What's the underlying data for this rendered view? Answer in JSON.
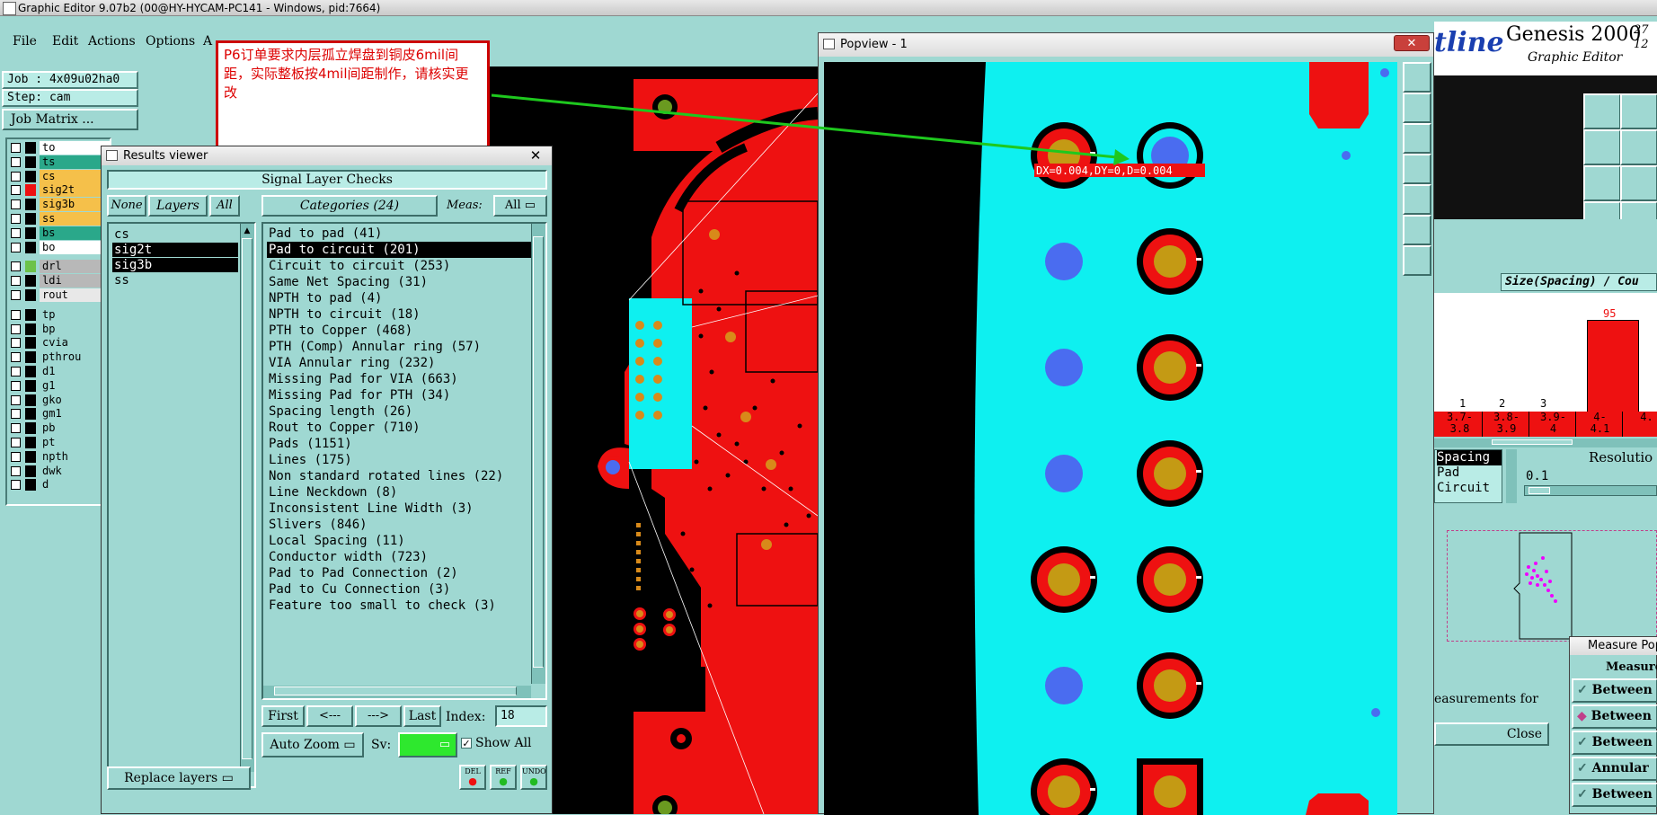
{
  "titlebar": {
    "title": "Graphic Editor 9.07b2 (00@HY-HYCAM-PC141 - Windows, pid:7664)"
  },
  "menu": {
    "file": "File",
    "edit": "Edit",
    "actions": "Actions",
    "options": "Options",
    "a": "A"
  },
  "job": {
    "job_line": "Job : 4x09u02ha0",
    "step_line": "Step: cam",
    "matrix_button": "Job Matrix ..."
  },
  "layers": [
    {
      "name": "to",
      "color": "#ffffff"
    },
    {
      "name": "ts",
      "color": "#2aa88a"
    },
    {
      "name": "cs",
      "color": "#f5c04a"
    },
    {
      "name": "sig2t",
      "color": "#f5c04a",
      "swatch": "#e11"
    },
    {
      "name": "sig3b",
      "color": "#f5c04a"
    },
    {
      "name": "ss",
      "color": "#f5c04a"
    },
    {
      "name": "bs",
      "color": "#2aa88a"
    },
    {
      "name": "bo",
      "color": "#ffffff"
    },
    {
      "name": "drl",
      "color": "#b8b8b8",
      "swatch": "#6cc24a"
    },
    {
      "name": "ldi",
      "color": "#b8b8b8"
    },
    {
      "name": "rout",
      "color": "#e8e8e8"
    },
    {
      "name": "tp",
      "color": "#9fd8d2"
    },
    {
      "name": "bp",
      "color": "#9fd8d2"
    },
    {
      "name": "cvia",
      "color": "#9fd8d2"
    },
    {
      "name": "pthrou",
      "color": "#9fd8d2"
    },
    {
      "name": "d1",
      "color": "#9fd8d2"
    },
    {
      "name": "g1",
      "color": "#9fd8d2"
    },
    {
      "name": "gko",
      "color": "#9fd8d2"
    },
    {
      "name": "gm1",
      "color": "#9fd8d2"
    },
    {
      "name": "pb",
      "color": "#9fd8d2"
    },
    {
      "name": "pt",
      "color": "#9fd8d2"
    },
    {
      "name": "npth",
      "color": "#9fd8d2"
    },
    {
      "name": "dwk",
      "color": "#9fd8d2"
    },
    {
      "name": "d",
      "color": "#9fd8d2"
    }
  ],
  "note": {
    "text": "P6订单要求内层孤立焊盘到铜皮6mil间距，实际整板按4mil间距制作，请核实更改"
  },
  "results_viewer": {
    "title": "Results viewer",
    "header": "Signal Layer Checks",
    "none": "None",
    "layers": "Layers",
    "all": "All",
    "categories": "Categories (24)",
    "meas": "Meas:",
    "meas_value": "All",
    "layer_list": [
      {
        "name": "cs",
        "selected": false
      },
      {
        "name": "sig2t",
        "selected": true
      },
      {
        "name": "sig3b",
        "selected": true
      },
      {
        "name": "ss",
        "selected": false
      }
    ],
    "category_list": [
      {
        "label": "Pad to pad (41)",
        "selected": false
      },
      {
        "label": "Pad to circuit (201)",
        "selected": true
      },
      {
        "label": "Circuit to circuit (253)",
        "selected": false
      },
      {
        "label": "Same Net Spacing (31)",
        "selected": false
      },
      {
        "label": "NPTH to pad (4)",
        "selected": false
      },
      {
        "label": "NPTH to circuit (18)",
        "selected": false
      },
      {
        "label": "PTH to Copper (468)",
        "selected": false
      },
      {
        "label": "PTH (Comp) Annular ring (57)",
        "selected": false
      },
      {
        "label": "VIA Annular ring (232)",
        "selected": false
      },
      {
        "label": "Missing Pad for VIA (663)",
        "selected": false
      },
      {
        "label": "Missing Pad for PTH (34)",
        "selected": false
      },
      {
        "label": "Spacing length (26)",
        "selected": false
      },
      {
        "label": "Rout to Copper (710)",
        "selected": false
      },
      {
        "label": "Pads (1151)",
        "selected": false
      },
      {
        "label": "Lines (175)",
        "selected": false
      },
      {
        "label": "Non standard rotated lines (22)",
        "selected": false
      },
      {
        "label": "Line Neckdown (8)",
        "selected": false
      },
      {
        "label": "Inconsistent Line Width (3)",
        "selected": false
      },
      {
        "label": "Slivers (846)",
        "selected": false
      },
      {
        "label": "Local Spacing (11)",
        "selected": false
      },
      {
        "label": "Conductor width (723)",
        "selected": false
      },
      {
        "label": "Pad to Pad Connection (2)",
        "selected": false
      },
      {
        "label": "Pad to Cu Connection (3)",
        "selected": false
      },
      {
        "label": "Feature too small to check (3)",
        "selected": false
      }
    ],
    "first": "First",
    "prev": "<---",
    "next": "--->",
    "last": "Last",
    "index_label": "Index:",
    "index_value": "18",
    "auto_zoom": "Auto Zoom",
    "sv": "Sv:",
    "show_all": "Show All",
    "replace_layers": "Replace layers",
    "del": "DEL",
    "ref": "REF",
    "undo": "UNDO"
  },
  "popview": {
    "title": "Popview - 1",
    "measure_label": "DX=0.004,DY=0,D=0.004"
  },
  "right_panel": {
    "brand": "tline",
    "genesis": "Genesis 2000",
    "graphic_editor": "Graphic Editor",
    "ver_top": "27",
    "ver_bot": "12",
    "hist_title": "Size(Spacing) / Cou",
    "peak_label": "95",
    "bar_counts": [
      "1",
      "2",
      "3"
    ],
    "bins": [
      [
        "3.7-",
        "3.8"
      ],
      [
        "3.8-",
        "3.9"
      ],
      [
        "3.9-",
        "4"
      ],
      [
        "4-",
        "4.1"
      ],
      [
        "4.",
        ""
      ]
    ],
    "types": [
      "Spacing",
      "Pad",
      "Circuit"
    ],
    "resolution_label": "Resolutio",
    "resolution_value": "0.1",
    "measurements_for": "easurements for",
    "close": "Close",
    "measure_title": "Measure Pop",
    "measure_header": "Measure",
    "measure_options": [
      "Between",
      "Between",
      "Between",
      "Annular",
      "Between"
    ]
  },
  "chart_data": {
    "type": "bar",
    "title": "Size(Spacing) / Cou",
    "categories": [
      "3.7-3.8",
      "3.8-3.9",
      "3.9-4",
      "4-4.1"
    ],
    "values": [
      1,
      2,
      3,
      95
    ]
  }
}
